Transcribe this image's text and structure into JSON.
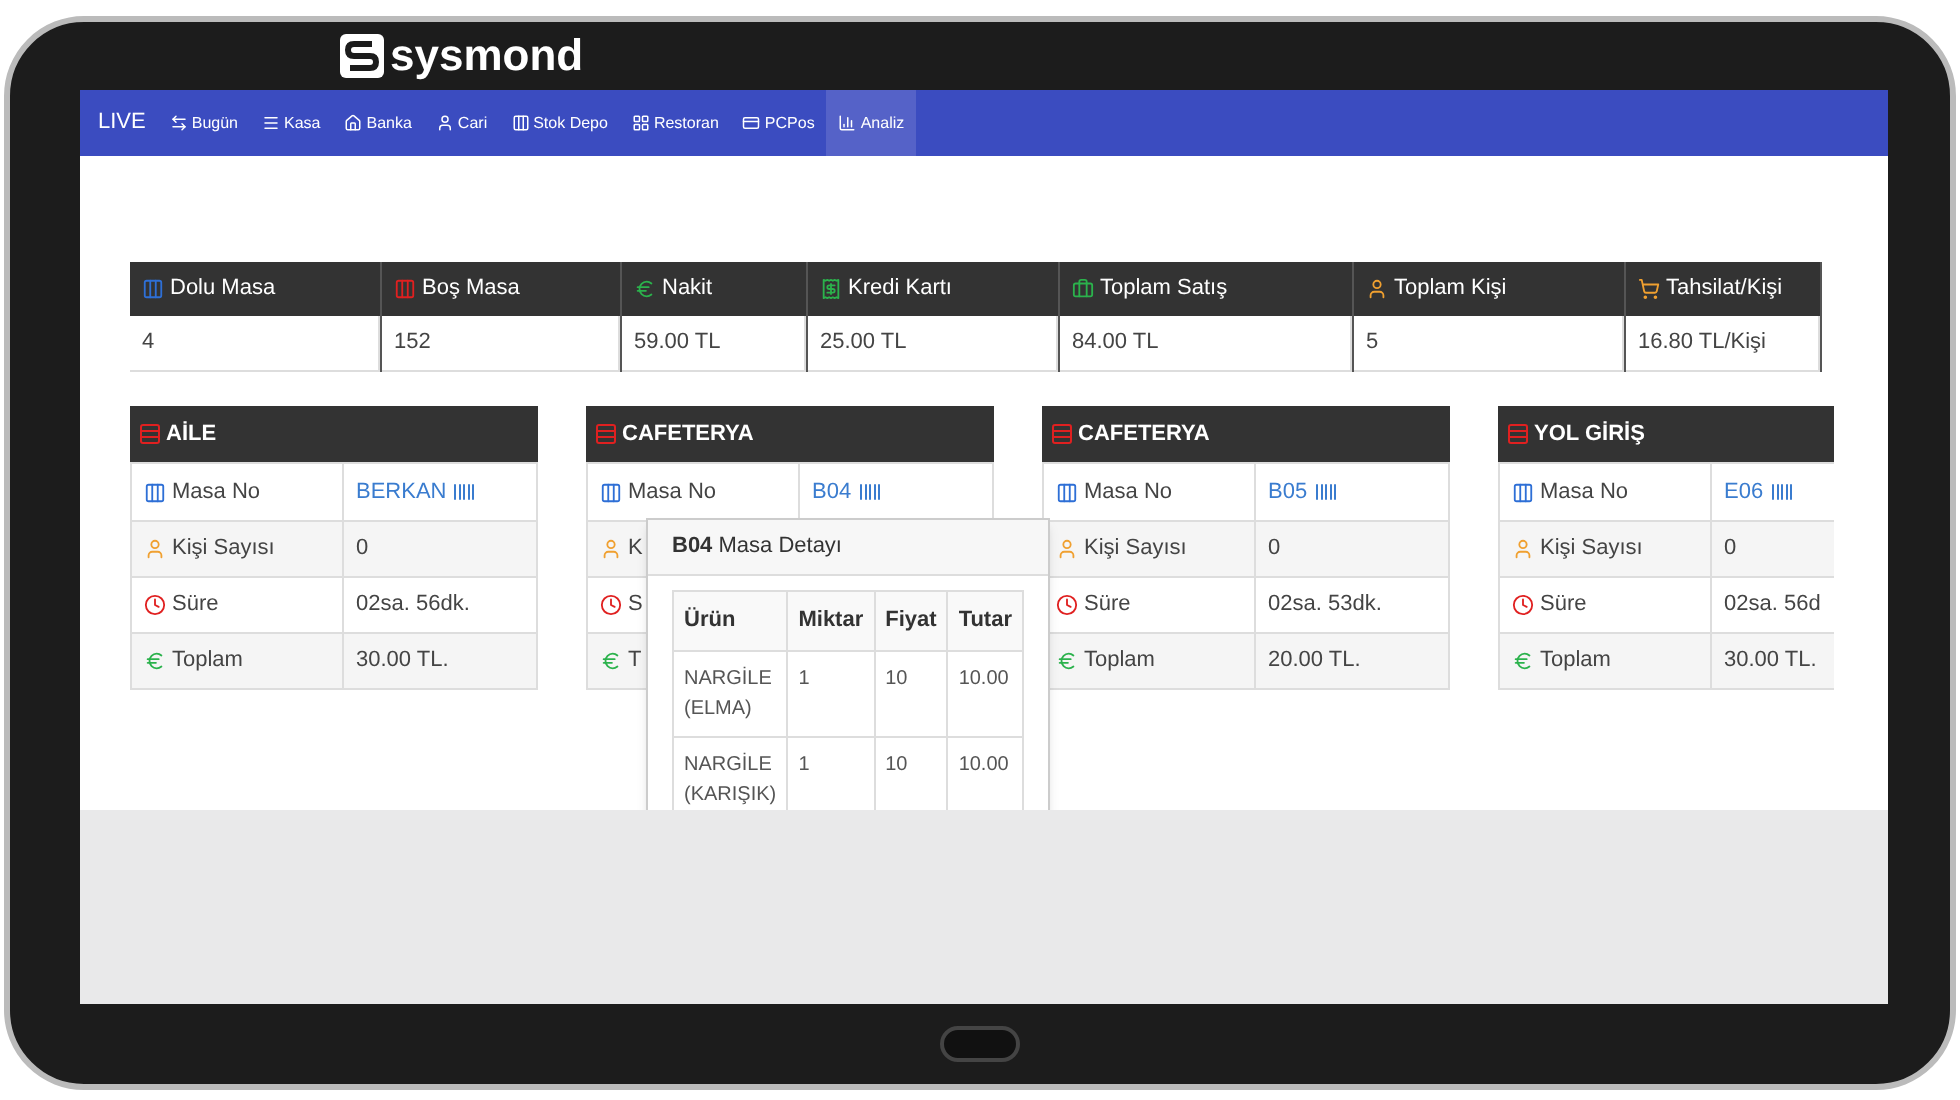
{
  "brand": {
    "name": "sysmond"
  },
  "nav": [
    {
      "label": "LIVE",
      "selected": false
    },
    {
      "label": "Bugün",
      "selected": false
    },
    {
      "label": "Kasa",
      "selected": false
    },
    {
      "label": "Banka",
      "selected": false
    },
    {
      "label": "Cari",
      "selected": false
    },
    {
      "label": "Stok Depo",
      "selected": false
    },
    {
      "label": "Restoran",
      "selected": false
    },
    {
      "label": "PCPos",
      "selected": false
    },
    {
      "label": "Analiz",
      "selected": true
    }
  ],
  "stats": [
    {
      "label": "Dolu Masa",
      "value": "4"
    },
    {
      "label": "Boş Masa",
      "value": "152"
    },
    {
      "label": "Nakit",
      "value": "59.00 TL"
    },
    {
      "label": "Kredi Kartı",
      "value": "25.00 TL"
    },
    {
      "label": "Toplam Satış",
      "value": "84.00 TL"
    },
    {
      "label": "Toplam Kişi",
      "value": "5"
    },
    {
      "label": "Tahsilat/Kişi",
      "value": "16.80 TL/Kişi"
    }
  ],
  "cards": [
    {
      "title": "AİLE",
      "rows": [
        {
          "kind": "table",
          "label": "Masa No",
          "value": "BERKAN"
        },
        {
          "kind": "people",
          "label": "Kişi Sayısı",
          "value": "0"
        },
        {
          "kind": "time",
          "label": "Süre",
          "value": "02sa. 56dk."
        },
        {
          "kind": "total",
          "label": "Toplam",
          "value": "30.00 TL."
        }
      ]
    },
    {
      "title": "CAFETERYA",
      "rows": [
        {
          "kind": "table",
          "label": "Masa No",
          "value": "B04"
        },
        {
          "kind": "people",
          "label": "K",
          "value": ""
        },
        {
          "kind": "time",
          "label": "S",
          "value": ""
        },
        {
          "kind": "total",
          "label": "T",
          "value": ""
        }
      ]
    },
    {
      "title": "CAFETERYA",
      "rows": [
        {
          "kind": "table",
          "label": "Masa No",
          "value": "B05"
        },
        {
          "kind": "people",
          "label": "Kişi Sayısı",
          "value": "0"
        },
        {
          "kind": "time",
          "label": "Süre",
          "value": "02sa. 53dk."
        },
        {
          "kind": "total",
          "label": "Toplam",
          "value": "20.00 TL."
        }
      ]
    },
    {
      "title": "YOL GİRİŞ",
      "rows": [
        {
          "kind": "table",
          "label": "Masa No",
          "value": "E06"
        },
        {
          "kind": "people",
          "label": "Kişi Sayısı",
          "value": "0"
        },
        {
          "kind": "time",
          "label": "Süre",
          "value": "02sa. 56d"
        },
        {
          "kind": "total",
          "label": "Toplam",
          "value": "30.00 TL."
        }
      ]
    }
  ],
  "popover": {
    "title": "**B04** Masa Detayı",
    "columns": [
      "Ürün",
      "Miktar",
      "Fiyat",
      "Tutar"
    ],
    "rows": [
      [
        "NARGİLE (ELMA)",
        "1",
        "10",
        "10.00"
      ],
      [
        "NARGİLE (KARIŞIK)",
        "1",
        "10",
        "10.00"
      ]
    ]
  }
}
